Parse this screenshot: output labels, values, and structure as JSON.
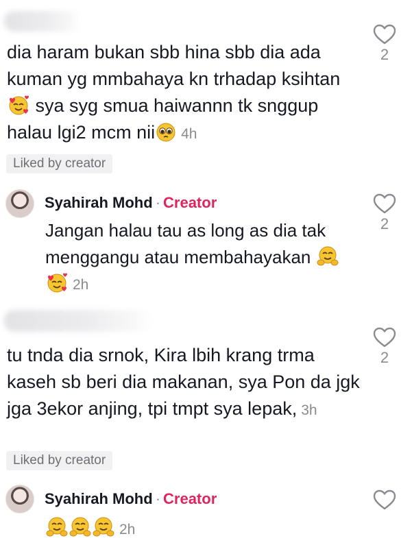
{
  "comments": [
    {
      "text_pre": "dia haram bukan sbb hina sbb dia ada kuman yg mmbahaya kn trhadap ksihtan",
      "text_mid": " sya syg smua haiwannn tk snggup halau lgi2 mcm nii",
      "time": "4h",
      "liked_label": "Liked by creator",
      "likes": "2",
      "emoji_1": "smiling-hearts-emoji",
      "emoji_2": "pleading-face-emoji"
    },
    {
      "text": "tu tnda dia srnok, Kira lbih krang trma kaseh sb beri dia makanan, sya Pon da jgk jga 3ekor anjing, tpi tmpt sya lepak,",
      "time": "3h",
      "liked_label": "Liked by creator",
      "likes": "2"
    }
  ],
  "replies": [
    {
      "name": "Syahirah Mohd",
      "dot": "·",
      "badge": "Creator",
      "text": "Jangan halau tau as long as dia tak menggangu atau membahayakan",
      "time": "2h",
      "likes": "2",
      "emojis": [
        "hugging-face-emoji",
        "smiling-hearts-emoji"
      ]
    },
    {
      "name": "Syahirah Mohd",
      "dot": "·",
      "badge": "Creator",
      "time": "2h",
      "likes": "",
      "emojis": [
        "hugging-face-emoji",
        "hugging-face-emoji",
        "hugging-face-emoji"
      ]
    }
  ],
  "colors": {
    "creator": "#e0245e",
    "muted": "#8a8b91",
    "text": "#161823"
  },
  "icons": {
    "like": "heart-outline-icon"
  }
}
